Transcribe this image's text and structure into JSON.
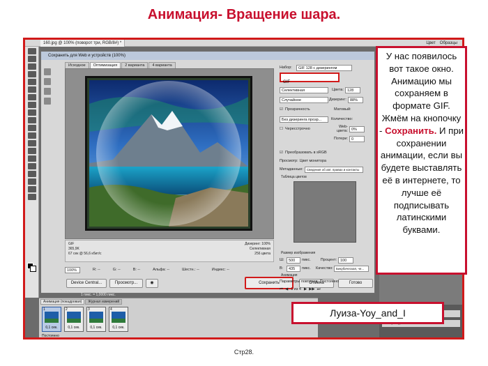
{
  "slide": {
    "title": "Анимация- Вращение шара.",
    "page_number": "Стр28."
  },
  "photoshop": {
    "document_tab": "160.jpg @ 100% (поворот три, RGB/8#) *",
    "right_tabs": [
      "Цвет",
      "Образцы"
    ],
    "tools_icons": [
      "move-icon",
      "marquee-icon",
      "lasso-icon",
      "magic-wand-icon",
      "crop-icon",
      "eyedropper-icon",
      "healing-icon",
      "brush-icon",
      "stamp-icon",
      "history-brush-icon",
      "eraser-icon",
      "gradient-icon",
      "blur-icon",
      "dodge-icon",
      "pen-icon",
      "type-icon",
      "path-select-icon",
      "shape-icon",
      "hand-icon",
      "zoom-icon"
    ]
  },
  "dialog": {
    "title": "Сохранить для Web и устройств (100%)",
    "tabs": [
      "Исходное",
      "Оптимизация",
      "2 варианта",
      "4 варианта"
    ],
    "active_tab": 1,
    "info_left": [
      "GIF",
      "365,9K",
      "67 сек @ 56,6 кбит/с"
    ],
    "info_right": [
      "Дизеринг: 100%",
      "Селективная",
      "256 цвета"
    ],
    "zoom_value": "100%",
    "readouts": [
      "R: --",
      "G: --",
      "B: --",
      "Альфа: --",
      "Шестн.: --",
      "Индекс: --"
    ],
    "buttons": {
      "device_central": "Device Central...",
      "preview": "Просмотр...",
      "save": "Сохранить",
      "cancel": "Отмена",
      "done": "Готово"
    },
    "options": {
      "preset_label": "Набор:",
      "preset_value": "GIF 128 с дизерингом",
      "format_value": "GIF",
      "reduction": "Селективная",
      "colors_label": "Цвета:",
      "colors_value": "128",
      "dither_method": "Случайное",
      "dither_label": "Дизеринг:",
      "dither_value": "88%",
      "transparency": "Прозрачность",
      "matte_label": "Матовый:",
      "transparency_dither": "Без дизеринга прозр...",
      "amount_label": "Количество:",
      "interlaced": "Чересстрочно",
      "web_snap_label": "Web-цвета:",
      "web_snap_value": "0%",
      "lossy_label": "Потери:",
      "lossy_value": "0",
      "convert_srgb": "Преобразовать в sRGB",
      "preview_label": "Просмотр:",
      "preview_value": "Цвет монитора",
      "metadata_label": "Метаданные:",
      "metadata_value": "Сведения об авт. правах и контакты",
      "color_table_label": "Таблица цветов",
      "image_size_label": "Размер изображения",
      "width_label": "Ш:",
      "width_value": "500",
      "height_label": "В:",
      "height_value": "435",
      "unit": "пикс.",
      "percent_label": "Процент:",
      "percent_value": "100",
      "quality_label": "Качество:",
      "quality_value": "Бикубическая, че...",
      "animation_label": "Анимация",
      "loop_label": "Параметры повторов:",
      "loop_value": "Постоянно",
      "frame_counter": "1 из 4"
    }
  },
  "timeline": {
    "tabs": [
      "Анимация (покадровая)",
      "Журнал измерений"
    ],
    "frames": [
      {
        "num": "1",
        "time": "0,1 сек."
      },
      {
        "num": "2",
        "time": "0,1 сек."
      },
      {
        "num": "3",
        "time": "0,1 сек."
      },
      {
        "num": "4",
        "time": "0,1 сек."
      }
    ],
    "loop": "Постоянно",
    "status_bar": "1 пикс. = 1,0000 пикс."
  },
  "layers": [
    "поворот один",
    "фон два"
  ],
  "callouts": {
    "text_before": "У нас появилось вот такое окно. Анимацию мы сохраняем в формате GIF. Жмём на кнопочку -",
    "text_highlight": "Сохранить.",
    "text_after": "И при сохранении анимации, если вы будете выставлять её в интернете, то лучше её подписывать латинскими буквами.",
    "author": "Луиза-Yoy_and_I"
  },
  "colors": {
    "title_red": "#c8102e",
    "frame_red": "#d11a1a"
  }
}
